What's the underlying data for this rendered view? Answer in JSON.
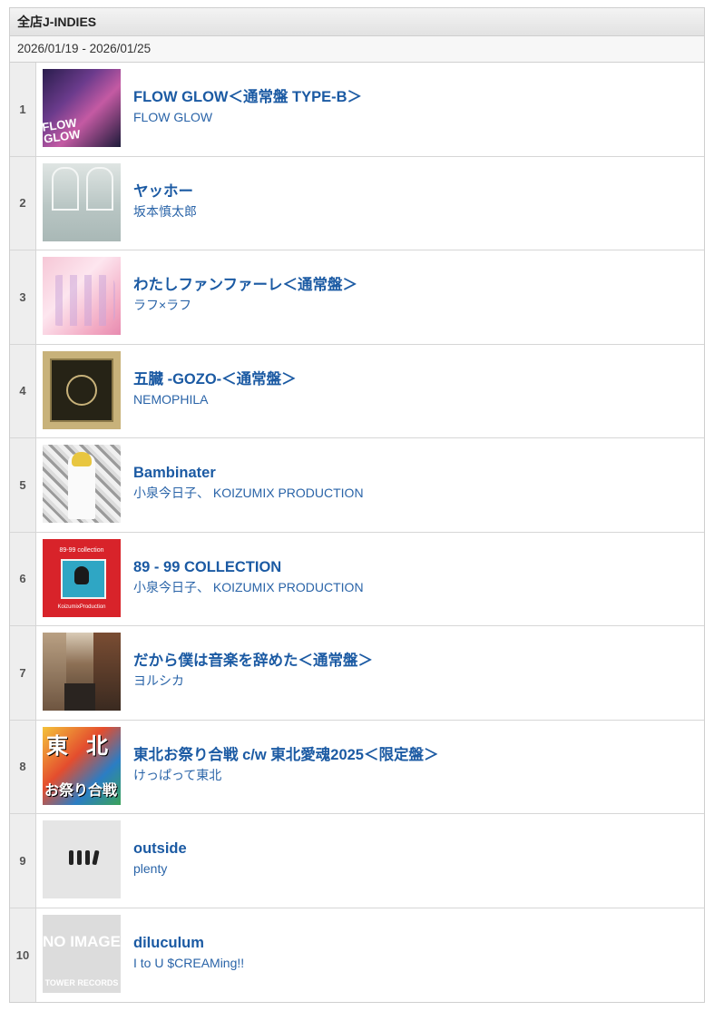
{
  "panel": {
    "title": "全店J-INDIES",
    "date_range": "2026/01/19 - 2026/01/25"
  },
  "rows": [
    {
      "rank": "1",
      "title": "FLOW GLOW＜通常盤 TYPE-B＞",
      "artist": "FLOW GLOW",
      "jacket_text": "FLOW GLOW"
    },
    {
      "rank": "2",
      "title": "ヤッホー",
      "artist": "坂本慎太郎"
    },
    {
      "rank": "3",
      "title": "わたしファンファーレ＜通常盤＞",
      "artist": "ラフ×ラフ"
    },
    {
      "rank": "4",
      "title": "五臓 -GOZO-＜通常盤＞",
      "artist": "NEMOPHILA"
    },
    {
      "rank": "5",
      "title": "Bambinater",
      "artist": "小泉今日子、 KOIZUMIX PRODUCTION"
    },
    {
      "rank": "6",
      "title": "89 - 99 COLLECTION",
      "artist": "小泉今日子、 KOIZUMIX PRODUCTION",
      "jacket_top": "89-99 collection",
      "jacket_bottom": "KoizumixProduction"
    },
    {
      "rank": "7",
      "title": "だから僕は音楽を辞めた＜通常盤＞",
      "artist": "ヨルシカ"
    },
    {
      "rank": "8",
      "title": "東北お祭り合戦 c/w 東北愛魂2025＜限定盤＞",
      "artist": "けっぱって東北",
      "jacket_k1": "東",
      "jacket_k2": "北",
      "jacket_bottom": "お祭り合戦"
    },
    {
      "rank": "9",
      "title": "outside",
      "artist": "plenty"
    },
    {
      "rank": "10",
      "title": "diluculum",
      "artist": "I to U $CREAMing!!",
      "jacket_top": "NO IMAGE",
      "jacket_bottom": "TOWER RECORDS"
    }
  ],
  "icons": {
    "jacket_1": "album-cover-image",
    "placeholder": "no-image-placeholder"
  }
}
